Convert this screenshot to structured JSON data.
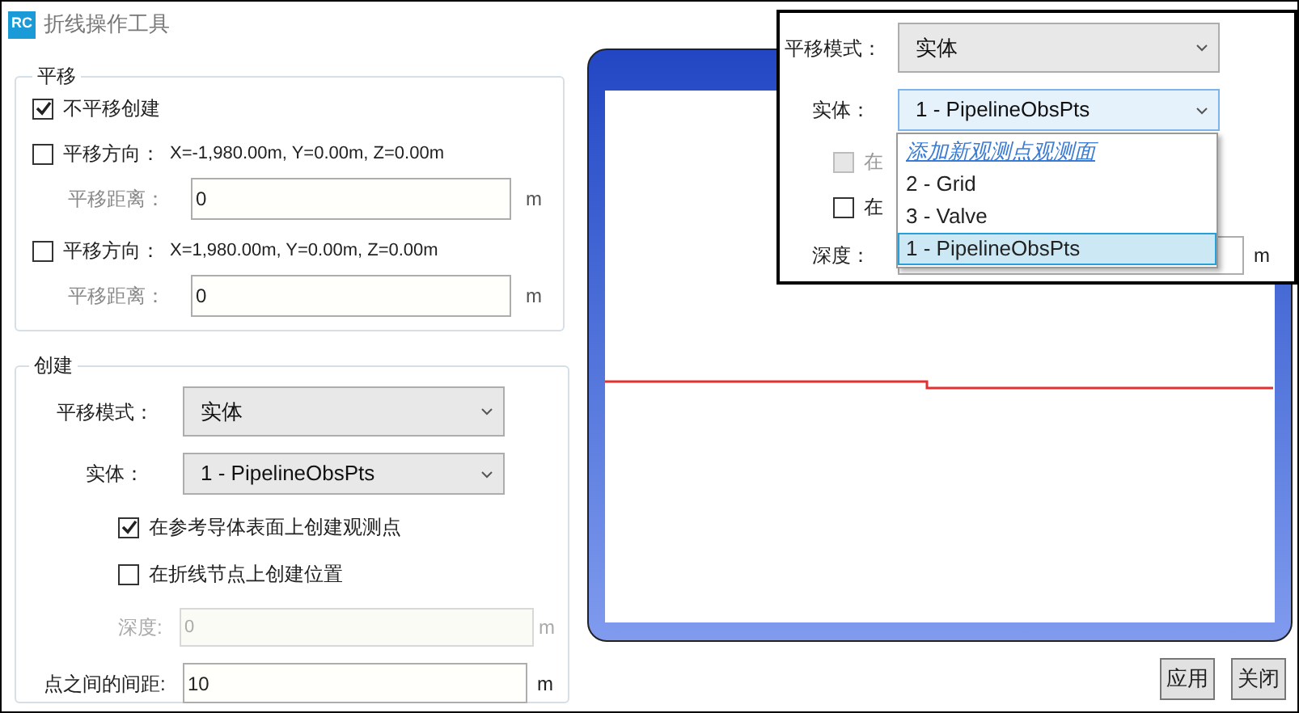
{
  "window": {
    "logo": "RC",
    "title": "折线操作工具"
  },
  "translate_group": {
    "title": "平移",
    "no_translate": {
      "label": "不平移创建",
      "checked": true
    },
    "directions": [
      {
        "label": "平移方向：",
        "value": "X=-1,980.00m, Y=0.00m, Z=0.00m",
        "checked": false,
        "distance_label": "平移距离：",
        "distance": "0",
        "unit": "m"
      },
      {
        "label": "平移方向：",
        "value": "X=1,980.00m, Y=0.00m, Z=0.00m",
        "checked": false,
        "distance_label": "平移距离：",
        "distance": "0",
        "unit": "m"
      }
    ]
  },
  "create_group": {
    "title": "创建",
    "mode": {
      "label": "平移模式：",
      "value": "实体"
    },
    "entity": {
      "label": "实体：",
      "value": "1 - PipelineObsPts"
    },
    "options": [
      {
        "label": "在参考导体表面上创建观测点",
        "checked": true
      },
      {
        "label": "在折线节点上创建位置",
        "checked": false
      }
    ],
    "depth": {
      "label": "深度:",
      "value": "0",
      "unit": "m",
      "disabled": true
    },
    "spacing": {
      "label": "点之间的间距:",
      "value": "10",
      "unit": "m"
    }
  },
  "buttons": [
    {
      "label": "应用"
    },
    {
      "label": "关闭"
    }
  ],
  "inset": {
    "mode": {
      "label": "平移模式：",
      "value": "实体"
    },
    "entity": {
      "label": "实体：",
      "value": "1 - PipelineObsPts"
    },
    "dropdown_items": [
      {
        "label": "添加新观测点观测面",
        "kind": "link",
        "selected": false
      },
      {
        "label": "2 - Grid",
        "kind": "option",
        "selected": false
      },
      {
        "label": "3 - Valve",
        "kind": "option",
        "selected": false
      },
      {
        "label": "1 - PipelineObsPts",
        "kind": "option",
        "selected": true
      }
    ],
    "options": [
      {
        "label": "在",
        "checked": false,
        "disabled": true
      },
      {
        "label": "在",
        "checked": false,
        "disabled": false
      }
    ],
    "depth": {
      "label": "深度：",
      "unit": "m"
    }
  }
}
